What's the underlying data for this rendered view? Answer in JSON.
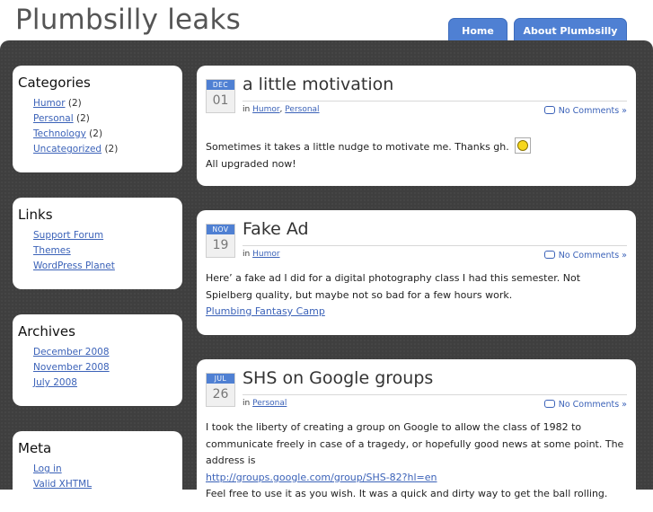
{
  "site": {
    "title": "Plumbsilly leaks"
  },
  "nav": {
    "tabs": [
      {
        "label": "Home"
      },
      {
        "label": "About Plumbsilly"
      }
    ]
  },
  "sidebar": {
    "categories": {
      "heading": "Categories",
      "items": [
        {
          "label": "Humor",
          "count": "(2)"
        },
        {
          "label": "Personal",
          "count": "(2)"
        },
        {
          "label": "Technology",
          "count": "(2)"
        },
        {
          "label": "Uncategorized",
          "count": "(2)"
        }
      ]
    },
    "links": {
      "heading": "Links",
      "items": [
        {
          "label": "Support Forum"
        },
        {
          "label": "Themes"
        },
        {
          "label": "WordPress Planet"
        }
      ]
    },
    "archives": {
      "heading": "Archives",
      "items": [
        {
          "label": "December 2008"
        },
        {
          "label": "November 2008"
        },
        {
          "label": "July 2008"
        }
      ]
    },
    "meta": {
      "heading": "Meta",
      "items": [
        {
          "label": "Log in"
        },
        {
          "label": "Valid XHTML"
        }
      ]
    }
  },
  "posts": [
    {
      "month": "DEC",
      "day": "01",
      "title": "a little motivation",
      "in_label": "in",
      "categories": [
        "Humor",
        "Personal"
      ],
      "separator": ",",
      "comments": "No Comments »",
      "lines": [
        "Sometimes it takes a little nudge to motivate me. Thanks gh.",
        "All upgraded now!"
      ]
    },
    {
      "month": "NOV",
      "day": "19",
      "title": "Fake Ad",
      "in_label": "in",
      "categories": [
        "Humor"
      ],
      "comments": "No Comments »",
      "lines": [
        "Here’ a fake ad I did for a digital photography class I had this semester. Not Spielberg quality, but maybe not so bad for a few hours work."
      ],
      "link": "Plumbing Fantasy Camp"
    },
    {
      "month": "JUL",
      "day": "26",
      "title": "SHS on Google groups",
      "in_label": "in",
      "categories": [
        "Personal"
      ],
      "comments": "No Comments »",
      "lines": [
        "I took the liberty of creating a group on Google to allow the class of 1982 to communicate freely in case of a tragedy, or hopefully good news at some point. The address is"
      ],
      "link": "http://groups.google.com/group/SHS-82?hl=en",
      "after_link": "Feel free to use it as you wish. It was a quick and dirty way to get the ball rolling."
    }
  ]
}
